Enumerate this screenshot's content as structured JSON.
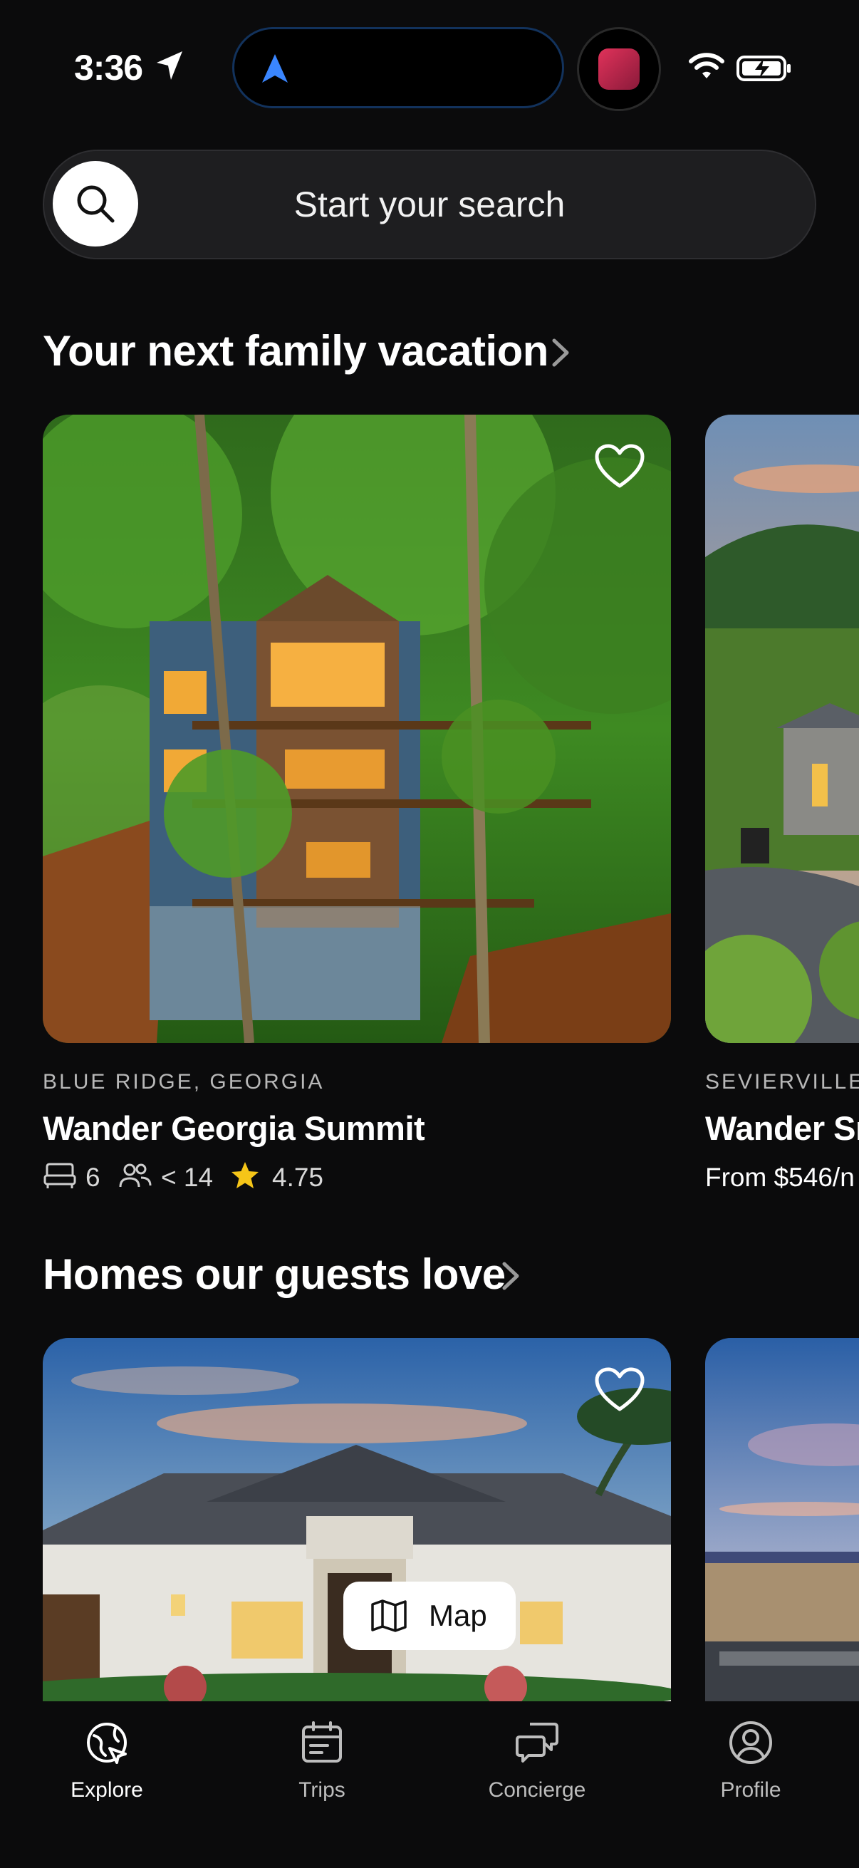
{
  "status": {
    "time": "3:36"
  },
  "search": {
    "placeholder": "Start your search"
  },
  "sections": [
    {
      "title": "Your next family vacation"
    },
    {
      "title": "Homes our guests love"
    }
  ],
  "listings": [
    {
      "location": "BLUE RIDGE, GEORGIA",
      "name": "Wander Georgia Summit",
      "beds": "6",
      "guests": "< 14",
      "rating": "4.75"
    },
    {
      "location": "SEVIERVILLE",
      "name": "Wander Sr",
      "price": "From $546/n"
    }
  ],
  "map_button": {
    "label": "Map"
  },
  "tabs": [
    {
      "label": "Explore",
      "icon": "explore-icon",
      "active": true
    },
    {
      "label": "Trips",
      "icon": "calendar-icon"
    },
    {
      "label": "Concierge",
      "icon": "chat-icon"
    },
    {
      "label": "Profile",
      "icon": "profile-icon"
    }
  ],
  "colors": {
    "background": "#0b0b0c",
    "accent": "#3a86ff",
    "star": "#f5c518"
  }
}
